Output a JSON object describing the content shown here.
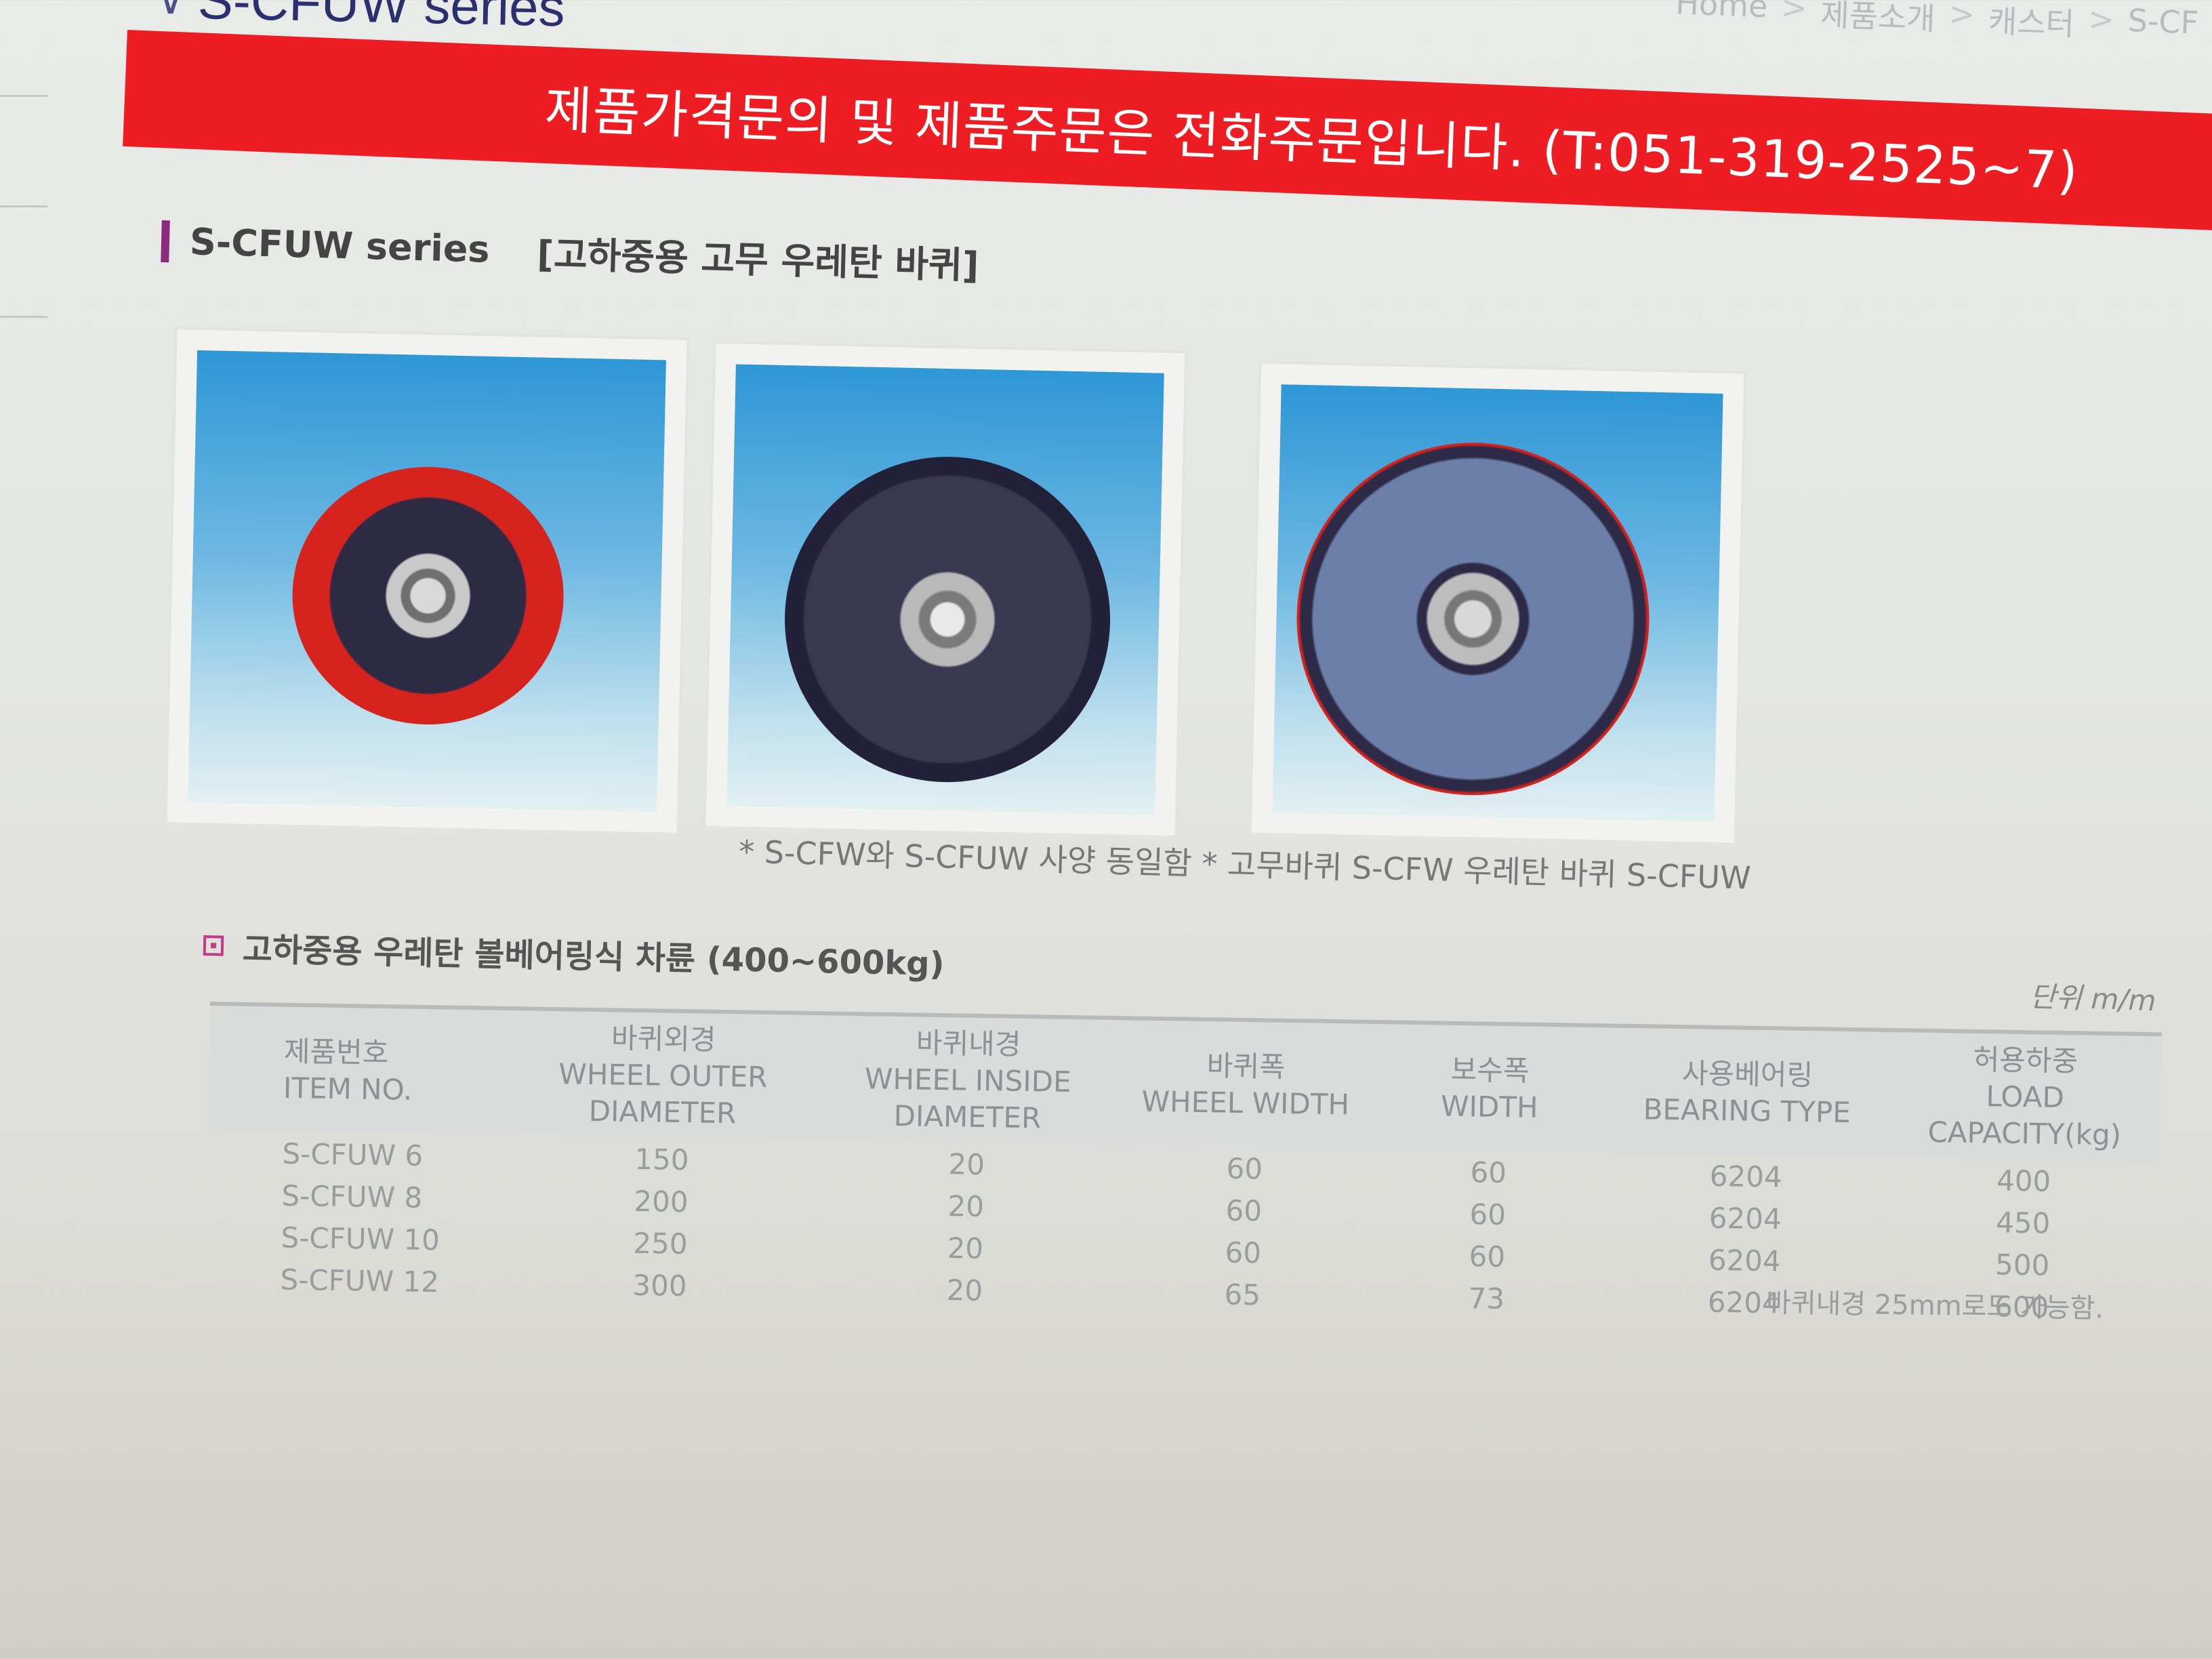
{
  "header": {
    "title": "S-CFUW series",
    "breadcrumb": [
      "Home",
      "제품소개",
      "캐스터",
      "S-CF"
    ]
  },
  "banner": {
    "text": "제품가격문의 및 제품주문은 전화주문입니다. (T:051-319-2525~7)"
  },
  "section": {
    "series": "S-CFUW series",
    "description": "[고하중용 고무 우레탄 바퀴]"
  },
  "photos": {
    "note": "* S-CFW와 S-CFUW 사양 동일함 * 고무바퀴 S-CFW 우레탄 바퀴 S-CFUW"
  },
  "spec": {
    "heading": "고하중용 우레탄 볼베어링식 차륜 (400~600kg)",
    "unit": "단위 m/m",
    "columns": [
      {
        "ko": "제품번호",
        "en": "ITEM NO."
      },
      {
        "ko": "바퀴외경",
        "en": "WHEEL OUTER DIAMETER"
      },
      {
        "ko": "바퀴내경",
        "en": "WHEEL INSIDE DIAMETER"
      },
      {
        "ko": "바퀴폭",
        "en": "WHEEL WIDTH"
      },
      {
        "ko": "보수폭",
        "en": "WIDTH"
      },
      {
        "ko": "사용베어링",
        "en": "BEARING TYPE"
      },
      {
        "ko": "허용하중",
        "en": "LOAD CAPACITY(kg)"
      }
    ],
    "rows": [
      [
        "S-CFUW 6",
        "150",
        "20",
        "60",
        "60",
        "6204",
        "400"
      ],
      [
        "S-CFUW 8",
        "200",
        "20",
        "60",
        "60",
        "6204",
        "450"
      ],
      [
        "S-CFUW 10",
        "250",
        "20",
        "60",
        "60",
        "6204",
        "500"
      ],
      [
        "S-CFUW 12",
        "300",
        "20",
        "65",
        "73",
        "6204",
        "600"
      ]
    ],
    "note": "바퀴내경 25mm로도 가능함."
  },
  "colors": {
    "banner": "#ee1c23",
    "heading_bar": "#8a2a7e",
    "accent_icon": "#c43a8a"
  }
}
